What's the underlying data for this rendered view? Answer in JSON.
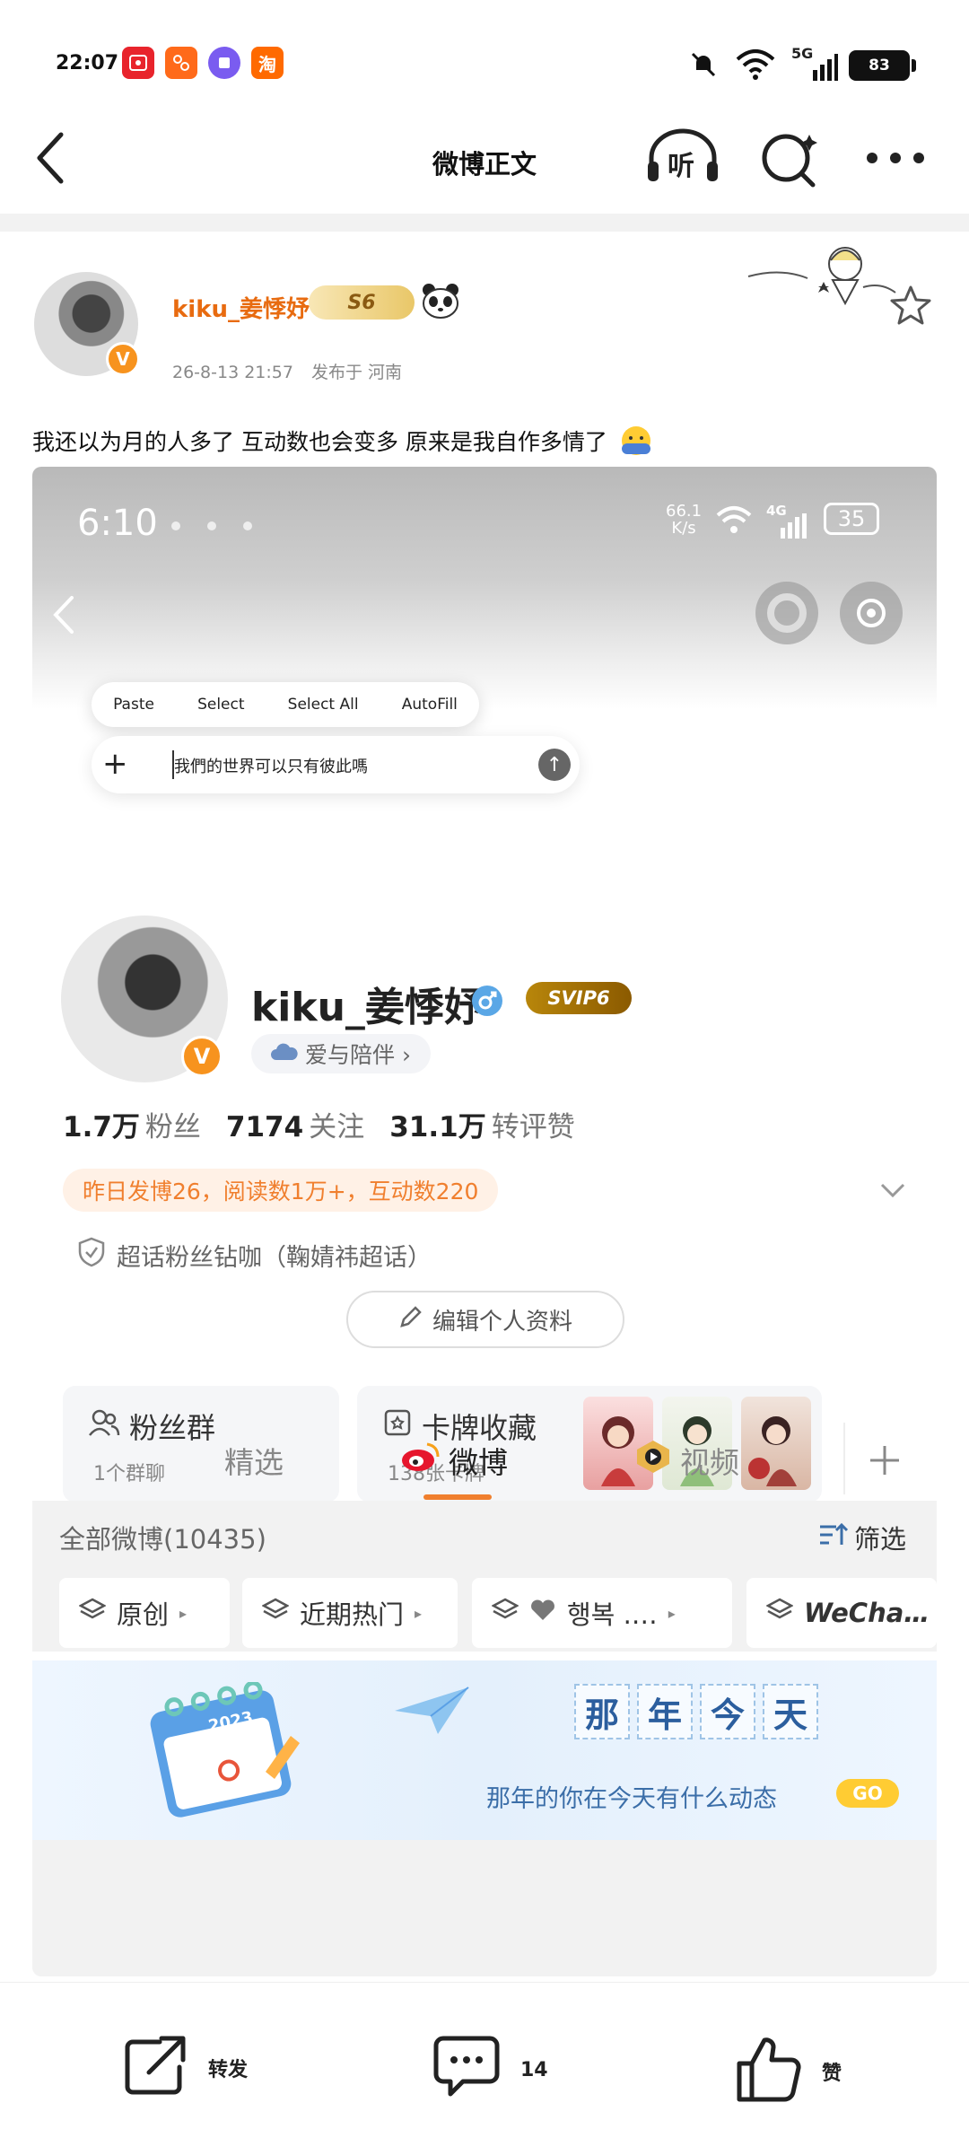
{
  "status_bar": {
    "time": "22:07",
    "battery": "83",
    "network": "5G",
    "apps": [
      "app-badge-1",
      "app-badge-2",
      "app-badge-3",
      "淘"
    ]
  },
  "nav": {
    "title": "微博正文",
    "listen_label": "听"
  },
  "post": {
    "username": "kiku_姜悸妤",
    "level_badge": "S6",
    "date": "26-8-13 21:57",
    "location": "发布于 河南",
    "text": "我还以为月的人多了 互动数也会变多 原来是我自作多情了"
  },
  "embedded": {
    "status_time": "6:10",
    "net_speed": "66.1",
    "net_unit": "K/s",
    "signal": "4G",
    "battery": "35",
    "context_menu": [
      "Paste",
      "Select",
      "Select All",
      "AutoFill"
    ],
    "input_text": "我們的世界可以只有彼此嗎",
    "profile": {
      "name": "kiku_姜悸妤",
      "svip": "SVIP6",
      "tag": "爱与陪伴 ›",
      "fans_value": "1.7万",
      "fans_label": "粉丝",
      "follow_value": "7174",
      "follow_label": "关注",
      "repost_value": "31.1万",
      "repost_label": "转评赞",
      "yesterday": "昨日发博26，阅读数1万+，互动数220",
      "superfan": "超话粉丝钻咖（鞠婧祎超话）",
      "edit": "编辑个人资料"
    },
    "cards": {
      "fan_group_title": "粉丝群",
      "fan_group_sub": "1个群聊",
      "card_collect_title": "卡牌收藏",
      "card_collect_sub": "138张卡牌"
    },
    "tabs": [
      "精选",
      "微博",
      "视频"
    ],
    "all_posts": "全部微博(10435)",
    "filter": "筛选",
    "chips": [
      "原创",
      "近期热门",
      "행복 .…",
      "WeCha…"
    ],
    "banner": {
      "chars": [
        "那",
        "年",
        "今",
        "天"
      ],
      "subtitle": "那年的你在今天有什么动态",
      "go": "GO",
      "calendar_year": "2023"
    }
  },
  "bottom_bar": {
    "repost": "转发",
    "comments": "14",
    "like": "赞"
  }
}
